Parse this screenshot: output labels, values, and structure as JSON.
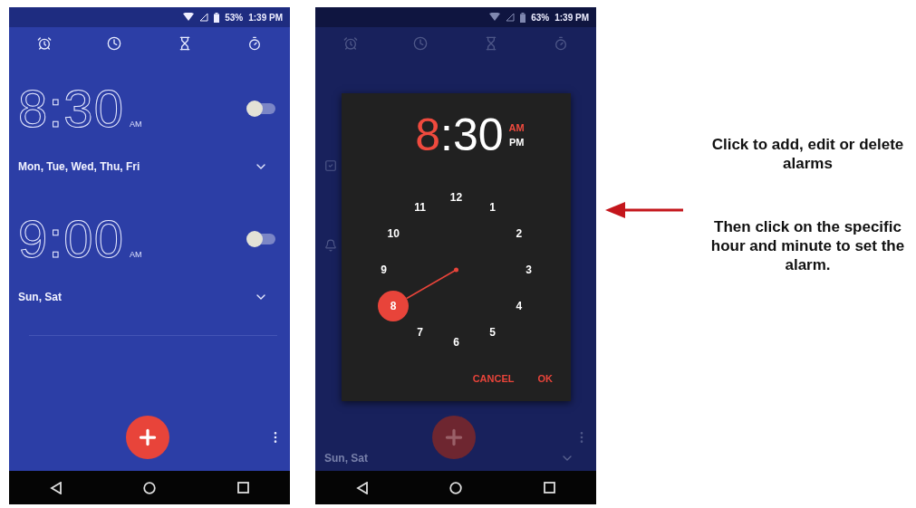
{
  "screens": [
    {
      "status_bar": {
        "battery": "53%",
        "time": "1:39 PM"
      },
      "dimmed": false,
      "alarms": [
        {
          "time": "8:30",
          "period": "AM",
          "days": "Mon, Tue, Wed, Thu, Fri",
          "on": false
        },
        {
          "time": "9:00",
          "period": "AM",
          "days": "Sun, Sat",
          "on": false
        }
      ]
    },
    {
      "status_bar": {
        "battery": "63%",
        "time": "1:39 PM"
      },
      "dimmed": true,
      "alarms": [
        {
          "days": "Sun, Sat"
        }
      ],
      "dialog": {
        "hour": "8",
        "minutes": ":30",
        "periods": [
          {
            "label": "AM",
            "selected": true
          },
          {
            "label": "PM",
            "selected": false
          }
        ],
        "dial": [
          {
            "label": "12",
            "selected": false
          },
          {
            "label": "1",
            "selected": false
          },
          {
            "label": "2",
            "selected": false
          },
          {
            "label": "3",
            "selected": false
          },
          {
            "label": "4",
            "selected": false
          },
          {
            "label": "5",
            "selected": false
          },
          {
            "label": "6",
            "selected": false
          },
          {
            "label": "7",
            "selected": false
          },
          {
            "label": "8",
            "selected": true
          },
          {
            "label": "9",
            "selected": false
          },
          {
            "label": "10",
            "selected": false
          },
          {
            "label": "11",
            "selected": false
          }
        ],
        "actions": [
          "CANCEL",
          "OK"
        ]
      }
    }
  ],
  "notes": [
    "Click to add, edit or delete alarms",
    "Then click on the specific hour and minute to set the alarm."
  ]
}
